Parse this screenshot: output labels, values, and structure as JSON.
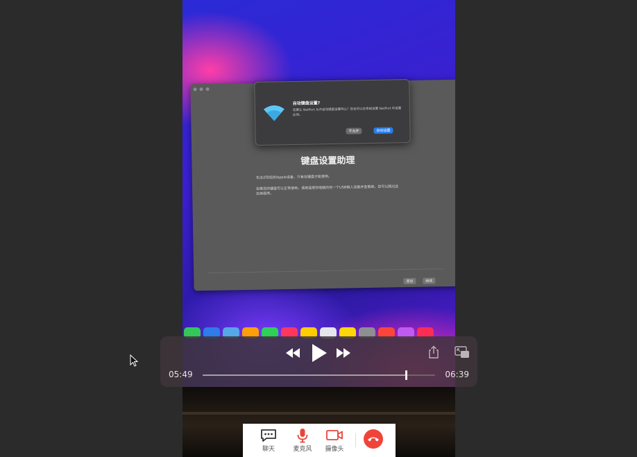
{
  "video": {
    "mac_window": {
      "title": "键盘设置助理",
      "para1": "无法识别您的Apple设备，只有在键盘才能使用。",
      "para2": "如果您的键盘可以正常使用，请按连接到电脑的另一个USB输入设备并查看继，您可以跳过此应用程序。",
      "btn_back": "退出",
      "btn_continue": "继续"
    },
    "dialog": {
      "title": "自动键盘设置?",
      "body": "您要让 NetPort 允许自动键盘设置吗么？您也可以在系统设置 NetPort 中设置此项。",
      "btn_decline": "不允许",
      "btn_accept": "自动设置"
    }
  },
  "player": {
    "current_time": "05:49",
    "duration": "06:39",
    "progress": 0.874,
    "icons": {
      "rewind": "rewind-icon",
      "play": "play-icon",
      "fast_forward": "fast-forward-icon",
      "share": "share-icon",
      "picture_in_picture": "picture-in-picture-icon"
    }
  },
  "call_bar": {
    "chat_label": "聊天",
    "mic_label": "麦克风",
    "camera_label": "摄像头",
    "hangup_icon": "phone-hangup-icon",
    "accent_color": "#f0443b"
  }
}
